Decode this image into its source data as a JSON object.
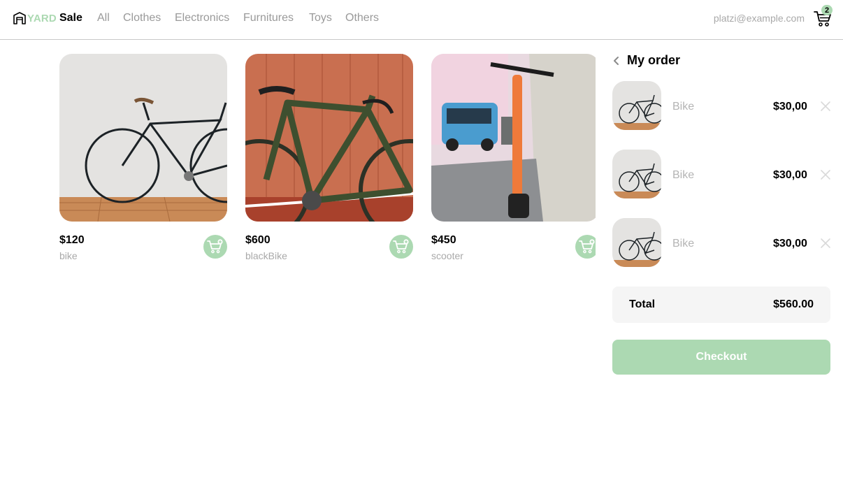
{
  "brand": {
    "logo_yard": "YARD",
    "logo_sale": "Sale"
  },
  "nav": {
    "links": [
      "All",
      "Clothes",
      "Electronics",
      "Furnitures",
      "Toys",
      "Others"
    ],
    "email": "platzi@example.com",
    "cart_count": "2"
  },
  "products": [
    {
      "price": "$120",
      "name": "bike",
      "image": "white-wall-bicycle"
    },
    {
      "price": "$600",
      "name": "blackBike",
      "image": "green-road-bike-orange-wall"
    },
    {
      "price": "$450",
      "name": "scooter",
      "image": "orange-electric-scooter-street"
    }
  ],
  "order": {
    "title": "My order",
    "items": [
      {
        "name": "Bike",
        "price": "$30,00",
        "image": "white-wall-bicycle"
      },
      {
        "name": "Bike",
        "price": "$30,00",
        "image": "white-wall-bicycle"
      },
      {
        "name": "Bike",
        "price": "$30,00",
        "image": "white-wall-bicycle"
      }
    ],
    "total_label": "Total",
    "total_value": "$560.00",
    "checkout_label": "Checkout"
  },
  "colors": {
    "accent": "#acd9b2",
    "muted_text": "#a9a9a9",
    "border": "#c8c8c8"
  }
}
